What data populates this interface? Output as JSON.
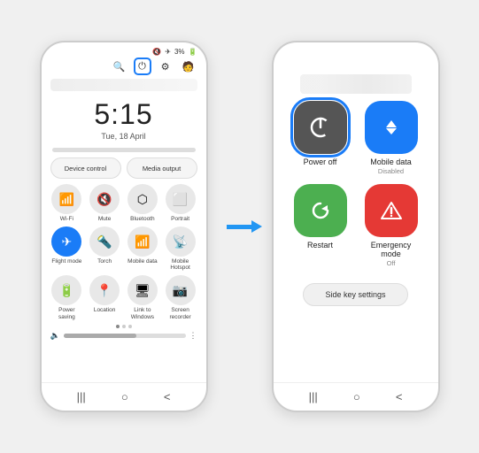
{
  "left_phone": {
    "status": {
      "battery": "3%",
      "icons": [
        "🔇",
        "✈",
        "❊"
      ]
    },
    "quick_icons": {
      "search": "🔍",
      "power": "⏻",
      "gear": "⚙",
      "person": "👤"
    },
    "time": "5:15",
    "date": "Tue, 18 April",
    "control_buttons": {
      "device": "Device control",
      "media": "Media output"
    },
    "tiles": [
      {
        "icon": "📶",
        "label": "Wi-Fi",
        "active": false
      },
      {
        "icon": "🔇",
        "label": "Mute",
        "active": false
      },
      {
        "icon": "⬡",
        "label": "Bluetooth",
        "active": false
      },
      {
        "icon": "⬜",
        "label": "Portrait",
        "active": false
      },
      {
        "icon": "✈",
        "label": "Flight mode",
        "active": true
      },
      {
        "icon": "🔦",
        "label": "Torch",
        "active": false
      },
      {
        "icon": "📱",
        "label": "Mobile data",
        "active": false
      },
      {
        "icon": "📡",
        "label": "Mobile Hotspot",
        "active": false
      },
      {
        "icon": "🔋",
        "label": "Power saving",
        "active": false
      },
      {
        "icon": "📍",
        "label": "Location",
        "active": false
      },
      {
        "icon": "🖥",
        "label": "Link to Windows",
        "active": false
      },
      {
        "icon": "📷",
        "label": "Screen recorder",
        "active": false
      }
    ],
    "nav": [
      "|||",
      "○",
      "<"
    ]
  },
  "arrow": "→",
  "right_phone": {
    "blurred_text": "blurred title",
    "power_items": [
      {
        "id": "power-off",
        "icon": "⏻",
        "label": "Power off",
        "sublabel": "",
        "color": "dark",
        "highlighted": true
      },
      {
        "id": "mobile-data",
        "icon": "↕",
        "label": "Mobile data",
        "sublabel": "Disabled",
        "color": "blue",
        "highlighted": false
      },
      {
        "id": "restart",
        "icon": "↺",
        "label": "Restart",
        "sublabel": "",
        "color": "green",
        "highlighted": false
      },
      {
        "id": "emergency",
        "icon": "⚠",
        "label": "Emergency mode",
        "sublabel": "Off",
        "color": "red",
        "highlighted": false
      }
    ],
    "side_key_btn": "Side key settings",
    "nav": [
      "|||",
      "○",
      "<"
    ]
  }
}
